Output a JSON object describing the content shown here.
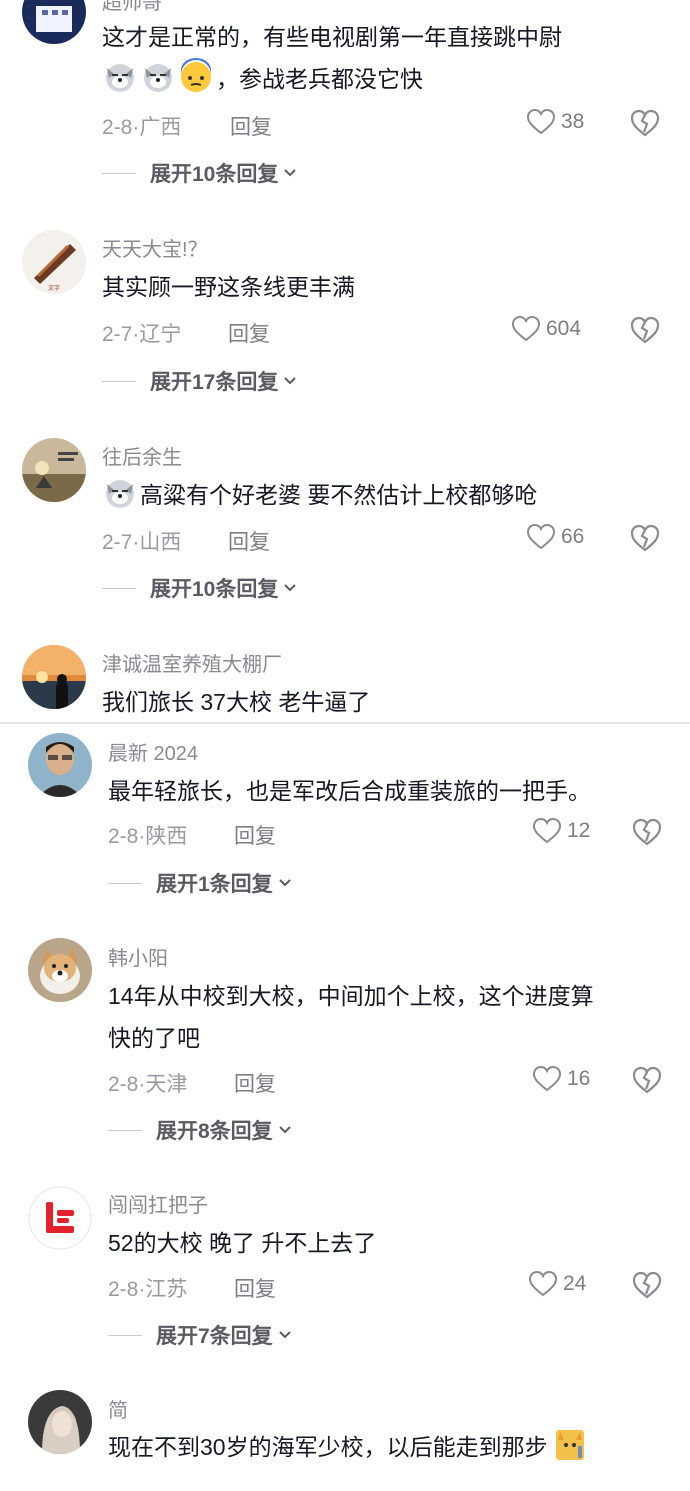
{
  "c1": {
    "username": "超帅哥",
    "text_line1": "这才是正常的，有些电视剧第一年直接跳中尉",
    "text_line2": "，参战老兵都没它快",
    "date": "2-8",
    "location": "广西",
    "reply_label": "回复",
    "likes": "38",
    "expand": "展开10条回复"
  },
  "c2": {
    "username": "天天大宝!？",
    "text": "其实顾一野这条线更丰满",
    "date": "2-7",
    "location": "辽宁",
    "reply_label": "回复",
    "likes": "604",
    "expand": "展开17条回复"
  },
  "c3": {
    "username": "往后余生",
    "text": "高粱有个好老婆 要不然估计上校都够呛",
    "date": "2-7",
    "location": "山西",
    "reply_label": "回复",
    "likes": "66",
    "expand": "展开10条回复"
  },
  "c4": {
    "username": "津诚温室养殖大棚厂",
    "text": "我们旅长 37大校 老牛逼了"
  },
  "c5": {
    "username": "晨新 2024",
    "text": "最年轻旅长，也是军改后合成重装旅的一把手。",
    "date": "2-8",
    "location": "陕西",
    "reply_label": "回复",
    "likes": "12",
    "expand": "展开1条回复"
  },
  "c6": {
    "username": "韩小阳",
    "text_line1": "14年从中校到大校，中间加个上校，这个进度算",
    "text_line2": "快的了吧",
    "date": "2-8",
    "location": "天津",
    "reply_label": "回复",
    "likes": "16",
    "expand": "展开8条回复"
  },
  "c7": {
    "username": "闯闯扛把子",
    "text": "52的大校 晚了 升不上去了",
    "date": "2-8",
    "location": "江苏",
    "reply_label": "回复",
    "likes": "24",
    "expand": "展开7条回复"
  },
  "c8": {
    "username": "简",
    "text": "现在不到30岁的海军少校，以后能走到那步"
  },
  "icons": {
    "like": "heart-outline-icon",
    "dislike": "broken-heart-icon",
    "expand": "chevron-down-icon"
  },
  "colors": {
    "text": "#161823",
    "secondary": "#8a8b91",
    "meta": "#9a9ba0"
  }
}
